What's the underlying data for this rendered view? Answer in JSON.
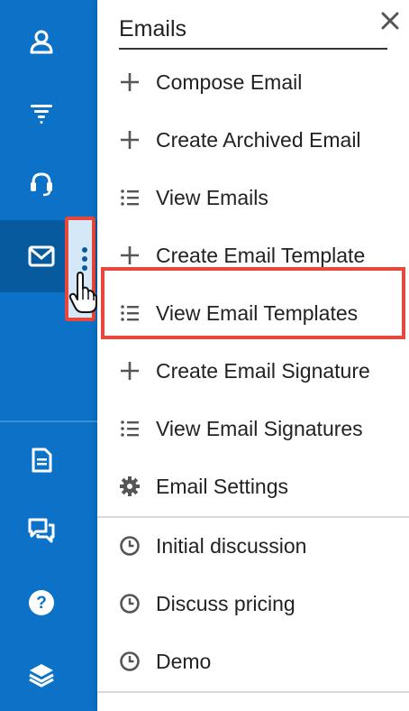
{
  "sidebar": {
    "items": [
      {
        "icon": "contacts-icon"
      },
      {
        "icon": "filter-icon"
      },
      {
        "icon": "headset-icon"
      },
      {
        "icon": "mail-icon",
        "active": true
      },
      {
        "icon": "document-icon"
      },
      {
        "icon": "chat-icon"
      },
      {
        "icon": "help-icon"
      },
      {
        "icon": "layers-icon"
      }
    ],
    "more_icon": "kebab-icon"
  },
  "menu": {
    "title": "Emails",
    "close_icon": "close-icon",
    "items": [
      {
        "label": "Compose Email",
        "icon": "plus-icon"
      },
      {
        "label": "Create Archived Email",
        "icon": "plus-icon"
      },
      {
        "label": "View Emails",
        "icon": "list-icon"
      },
      {
        "label": "Create Email Template",
        "icon": "plus-icon"
      },
      {
        "label": "View Email Templates",
        "icon": "list-icon",
        "highlighted": true
      },
      {
        "label": "Create Email Signature",
        "icon": "plus-icon"
      },
      {
        "label": "View Email Signatures",
        "icon": "list-icon"
      },
      {
        "label": "Email Settings",
        "icon": "gear-icon"
      }
    ],
    "recent": [
      {
        "label": "Initial discussion",
        "icon": "clock-icon"
      },
      {
        "label": "Discuss pricing",
        "icon": "clock-icon"
      },
      {
        "label": "Demo",
        "icon": "clock-icon"
      }
    ]
  },
  "colors": {
    "sidebar": "#0b72c8",
    "sidebar_active": "#075a9e",
    "highlight": "#e8483b"
  }
}
